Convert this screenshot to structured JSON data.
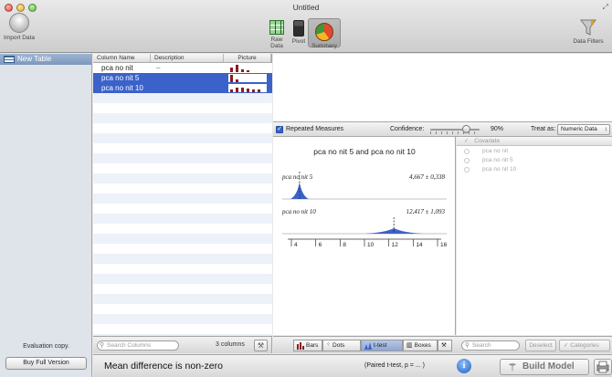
{
  "window": {
    "title": "Untitled"
  },
  "toolbar": {
    "import_label": "Import Data",
    "raw_data_label": "Raw Data",
    "pivot_label": "Pivot",
    "summary_label": "Summary",
    "data_filters_label": "Data Filters"
  },
  "sidebar": {
    "selected_table": "New Table",
    "eval_text": "Evaluation copy.",
    "buy_button": "Buy Full Version"
  },
  "columns": {
    "headers": {
      "name": "Column Name",
      "description": "Description",
      "picture": "Picture"
    },
    "rows": [
      {
        "name": "pca no nit",
        "description": "–",
        "selected": false,
        "bars": [
          0.5,
          0.9,
          0.35,
          0.2
        ]
      },
      {
        "name": "pca no nit 5",
        "description": "",
        "selected": true,
        "bars": [
          0.9,
          0.3
        ]
      },
      {
        "name": "pca no nit 10",
        "description": "",
        "selected": true,
        "bars": [
          0.3,
          0.5,
          0.6,
          0.4,
          0.3,
          0.3
        ]
      }
    ],
    "search_placeholder": "Search Columns",
    "count": "3 columns"
  },
  "options": {
    "repeated_measures": "Repeated Measures",
    "confidence_label": "Confidence:",
    "confidence_value": "90%",
    "confidence": 0.9,
    "treat_as_label": "Treat as:",
    "treat_as_value": "Numeric Data"
  },
  "chart_data": {
    "type": "t-test",
    "title": "pca no nit 5 and pca no nit 10",
    "series": [
      {
        "name": "pca no nit 5",
        "stat": "4,667 ± 0,338",
        "mean": 4.667,
        "ci": 0.338
      },
      {
        "name": "pca no nit 10",
        "stat": "12,417 ± 1,093",
        "mean": 12.417,
        "ci": 1.093
      }
    ],
    "x_ticks": [
      "4",
      "6",
      "8",
      "10",
      "12",
      "14",
      "16"
    ],
    "xlim": [
      4,
      16
    ]
  },
  "covariate": {
    "header": "Covariate",
    "items": [
      "pca no nit",
      "pca no nit 5",
      "pca no nit 10"
    ]
  },
  "chart_tools": {
    "bars": "Bars",
    "dots": "Dots",
    "ttest": "t-test",
    "boxes": "Boxes",
    "search_placeholder": "Search",
    "deselect": "Deselect",
    "categories": "Categories"
  },
  "status": {
    "message": "Mean difference is non-zero",
    "test": "(Paired t-test, p = ... )",
    "info": "i",
    "build_model": "Build Model"
  },
  "colors": {
    "selection": "#3b62c9",
    "distribution": "#3b62c9",
    "picture_bars": "#8c1c1c"
  }
}
